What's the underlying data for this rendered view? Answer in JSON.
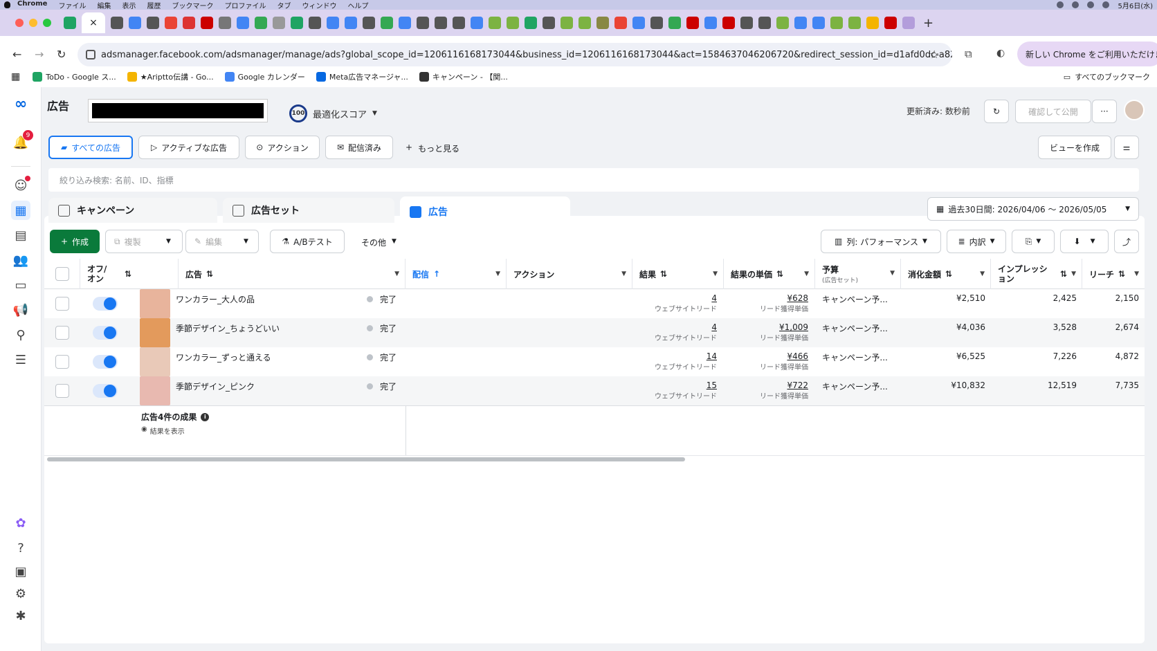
{
  "macbar": {
    "menu": [
      "Chrome",
      "ファイル",
      "編集",
      "表示",
      "履歴",
      "ブックマーク",
      "プロファイル",
      "タブ",
      "ウィンドウ",
      "ヘルプ"
    ],
    "clock": "5月6日(水)"
  },
  "browser": {
    "url": "adsmanager.facebook.com/adsmanager/manage/ads?global_scope_id=1206116168173044&business_id=1206116168173044&act=1584637046206720&redirect_session_id=d1afd0dc-a82c-441...",
    "new_chrome_label": "新しい Chrome をご利用いただけます",
    "bookmarks": [
      {
        "label": "ToDo - Google ス...",
        "color": "#1fa463"
      },
      {
        "label": "★Ariptto伝講 - Go...",
        "color": "#f4b400"
      },
      {
        "label": "Google カレンダー",
        "color": "#4285f4"
      },
      {
        "label": "Meta広告マネージャ...",
        "color": "#0668e1"
      },
      {
        "label": "キャンペーン - 【関...",
        "color": "#333333"
      }
    ],
    "all_bookmarks": "すべてのブックマーク",
    "tab_favicons": [
      "#1fa463",
      "#555",
      "#4285f4",
      "#555",
      "#ea4335",
      "#d33",
      "#c00",
      "#777",
      "#4285f4",
      "#34a853",
      "#999",
      "#1fa463",
      "#555",
      "#4285f4",
      "#4285f4",
      "#555",
      "#34a853",
      "#4285f4",
      "#555",
      "#555",
      "#555",
      "#4285f4",
      "#7cb342",
      "#7cb342",
      "#1fa463",
      "#555",
      "#7cb342",
      "#7cb342",
      "#884",
      "#ea4335",
      "#4285f4",
      "#555",
      "#34a853",
      "#c00",
      "#4285f4",
      "#c00",
      "#555",
      "#555",
      "#7cb342",
      "#4285f4",
      "#4285f4",
      "#7cb342",
      "#7cb342",
      "#f4b400",
      "#c00",
      "#b39ddb"
    ]
  },
  "rail": {
    "notification_count": "9"
  },
  "header": {
    "title": "広告",
    "score_value": "100",
    "score_label": "最適化スコア",
    "updated": "更新済み: 数秒前",
    "publish": "確認して公開"
  },
  "views": {
    "all_ads": "すべての広告",
    "active_ads": "アクティブな広告",
    "actions": "アクション",
    "delivered": "配信済み",
    "more": "もっと見る",
    "create_view": "ビューを作成"
  },
  "filter": {
    "placeholder": "絞り込み検索: 名前、ID、指標"
  },
  "levels": {
    "campaign": "キャンペーン",
    "adset": "広告セット",
    "ad": "広告"
  },
  "date_range": "過去30日間: 2026/04/06 〜 2026/05/05",
  "toolbar": {
    "create": "作成",
    "duplicate": "複製",
    "edit": "編集",
    "ab_test": "A/Bテスト",
    "other": "その他",
    "columns": "列: パフォーマンス",
    "breakdown": "内訳"
  },
  "table": {
    "headers": {
      "onoff": "オフ/オン",
      "ad": "広告",
      "delivery": "配信",
      "action": "アクション",
      "results": "結果",
      "cost_per_result": "結果の単価",
      "budget": "予算",
      "budget_sub": "(広告セット)",
      "spend": "消化金額",
      "impressions": "インプレッション",
      "reach": "リーチ"
    },
    "rows": [
      {
        "name": "ワンカラー_大人の品",
        "delivery": "完了",
        "results": "4",
        "results_sub": "ウェブサイトリード",
        "cpr": "¥628",
        "cpr_sub": "リード獲得単価",
        "budget": "キャンペーン予...",
        "spend": "¥2,510",
        "impressions": "2,425",
        "reach": "2,150",
        "thumb": "#e8b49c"
      },
      {
        "name": "季節デザイン_ちょうどいい",
        "delivery": "完了",
        "results": "4",
        "results_sub": "ウェブサイトリード",
        "cpr": "¥1,009",
        "cpr_sub": "リード獲得単価",
        "budget": "キャンペーン予...",
        "spend": "¥4,036",
        "impressions": "3,528",
        "reach": "2,674",
        "thumb": "#e39a5c"
      },
      {
        "name": "ワンカラー_ずっと通える",
        "delivery": "完了",
        "results": "14",
        "results_sub": "ウェブサイトリード",
        "cpr": "¥466",
        "cpr_sub": "リード獲得単価",
        "budget": "キャンペーン予...",
        "spend": "¥6,525",
        "impressions": "7,226",
        "reach": "4,872",
        "thumb": "#e9c9b8"
      },
      {
        "name": "季節デザイン_ピンク",
        "delivery": "完了",
        "results": "15",
        "results_sub": "ウェブサイトリード",
        "cpr": "¥722",
        "cpr_sub": "リード獲得単価",
        "budget": "キャンペーン予...",
        "spend": "¥10,832",
        "impressions": "12,519",
        "reach": "7,735",
        "thumb": "#e8b9b0"
      }
    ],
    "summary_title": "広告4件の成果",
    "summary_link": "結果を表示"
  }
}
